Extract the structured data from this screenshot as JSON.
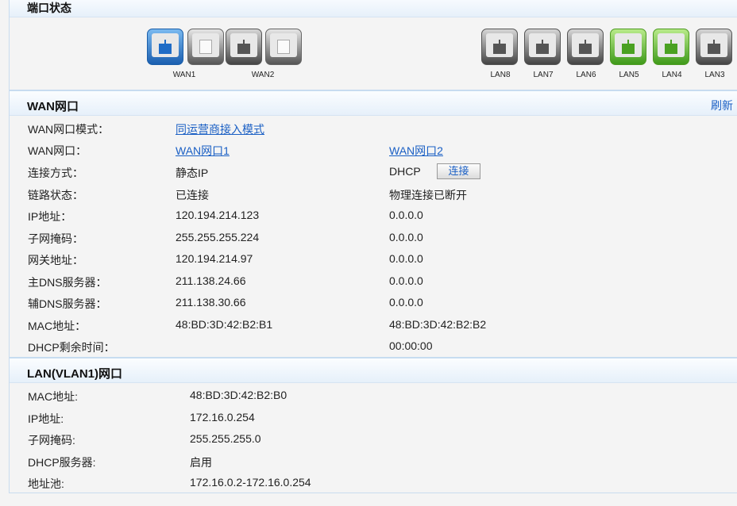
{
  "section_ports": {
    "title": "端口状态"
  },
  "ports": {
    "wan": [
      {
        "label": "WAN1",
        "state": "connected-blue"
      },
      {
        "state": "empty"
      },
      {
        "label": "WAN2",
        "state": "disconnected-gray"
      },
      {
        "state": "empty"
      }
    ],
    "lan": [
      {
        "label": "LAN8",
        "state": "gray"
      },
      {
        "label": "LAN7",
        "state": "gray"
      },
      {
        "label": "LAN6",
        "state": "gray"
      },
      {
        "label": "LAN5",
        "state": "green"
      },
      {
        "label": "LAN4",
        "state": "green"
      },
      {
        "label": "LAN3",
        "state": "gray"
      }
    ]
  },
  "wan": {
    "title": "WAN网口",
    "refresh": "刷新",
    "mode_label": "WAN网口模式：",
    "mode_value": "同运营商接入模式",
    "port_label": "WAN网口：",
    "port1": "WAN网口1",
    "port2": "WAN网口2",
    "connect_button": "连接",
    "rows": [
      {
        "label": "连接方式：",
        "v1": "静态IP",
        "v2": "DHCP"
      },
      {
        "label": "链路状态：",
        "v1": "已连接",
        "v2": "物理连接已断开"
      },
      {
        "label": "IP地址：",
        "v1": "120.194.214.123",
        "v2": "0.0.0.0"
      },
      {
        "label": "子网掩码：",
        "v1": "255.255.255.224",
        "v2": "0.0.0.0"
      },
      {
        "label": "网关地址：",
        "v1": "120.194.214.97",
        "v2": "0.0.0.0"
      },
      {
        "label": "主DNS服务器：",
        "v1": "211.138.24.66",
        "v2": "0.0.0.0"
      },
      {
        "label": "辅DNS服务器：",
        "v1": "211.138.30.66",
        "v2": "0.0.0.0"
      },
      {
        "label": "MAC地址：",
        "v1": "48:BD:3D:42:B2:B1",
        "v2": "48:BD:3D:42:B2:B2"
      },
      {
        "label": "DHCP剩余时间：",
        "v1": "",
        "v2": "00:00:00"
      }
    ]
  },
  "lan": {
    "title": "LAN(VLAN1)网口",
    "rows": [
      {
        "label": "MAC地址:",
        "value": "48:BD:3D:42:B2:B0"
      },
      {
        "label": "IP地址:",
        "value": "172.16.0.254"
      },
      {
        "label": "子网掩码:",
        "value": "255.255.255.0"
      },
      {
        "label": "DHCP服务器:",
        "value": "启用"
      },
      {
        "label": "地址池:",
        "value": "172.16.0.2-172.16.0.254"
      }
    ]
  }
}
